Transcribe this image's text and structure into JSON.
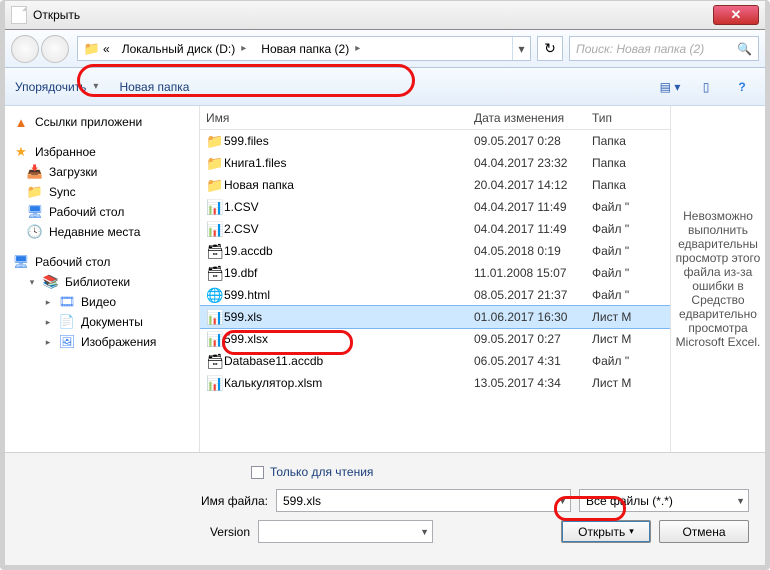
{
  "title": "Открыть",
  "address": {
    "prefix": "«",
    "seg1": "Локальный диск (D:)",
    "seg2": "Новая папка (2)"
  },
  "search": {
    "placeholder": "Поиск: Новая папка (2)"
  },
  "toolbar": {
    "organize": "Упорядочить",
    "newfolder": "Новая папка"
  },
  "nav": {
    "applinks": "Ссылки приложени",
    "favorites": "Избранное",
    "downloads": "Загрузки",
    "sync": "Sync",
    "desktop": "Рабочий стол",
    "recent": "Недавние места",
    "desktop2": "Рабочий стол",
    "libraries": "Библиотеки",
    "video": "Видео",
    "documents": "Документы",
    "pictures": "Изображения"
  },
  "columns": {
    "name": "Имя",
    "date": "Дата изменения",
    "type": "Тип"
  },
  "files": [
    {
      "icon": "folder",
      "name": "599.files",
      "date": "09.05.2017 0:28",
      "type": "Папка"
    },
    {
      "icon": "folder",
      "name": "Книга1.files",
      "date": "04.04.2017 23:32",
      "type": "Папка"
    },
    {
      "icon": "folder",
      "name": "Новая папка",
      "date": "20.04.2017 14:12",
      "type": "Папка"
    },
    {
      "icon": "xls",
      "name": "1.CSV",
      "date": "04.04.2017 11:49",
      "type": "Файл \""
    },
    {
      "icon": "xls",
      "name": "2.CSV",
      "date": "04.04.2017 11:49",
      "type": "Файл \""
    },
    {
      "icon": "db",
      "name": "19.accdb",
      "date": "04.05.2018 0:19",
      "type": "Файл \""
    },
    {
      "icon": "db",
      "name": "19.dbf",
      "date": "11.01.2008 15:07",
      "type": "Файл \""
    },
    {
      "icon": "html",
      "name": "599.html",
      "date": "08.05.2017 21:37",
      "type": "Файл \""
    },
    {
      "icon": "xls",
      "name": "599.xls",
      "date": "01.06.2017 16:30",
      "type": "Лист M",
      "selected": true
    },
    {
      "icon": "xls",
      "name": "599.xlsx",
      "date": "09.05.2017 0:27",
      "type": "Лист M"
    },
    {
      "icon": "db",
      "name": "Database11.accdb",
      "date": "06.05.2017 4:31",
      "type": "Файл \""
    },
    {
      "icon": "xls",
      "name": "Калькулятор.xlsm",
      "date": "13.05.2017 4:34",
      "type": "Лист M"
    }
  ],
  "preview_text": "Невозможно выполнить едварительны просмотр этого файла из-за ошибки в Средство едварительно просмотра Microsoft Excel.",
  "bottom": {
    "readonly": "Только для чтения",
    "filename_label": "Имя файла:",
    "filename_value": "599.xls",
    "filter": "Все файлы (*.*)",
    "version_label": "Version",
    "open": "Открыть",
    "cancel": "Отмена"
  }
}
